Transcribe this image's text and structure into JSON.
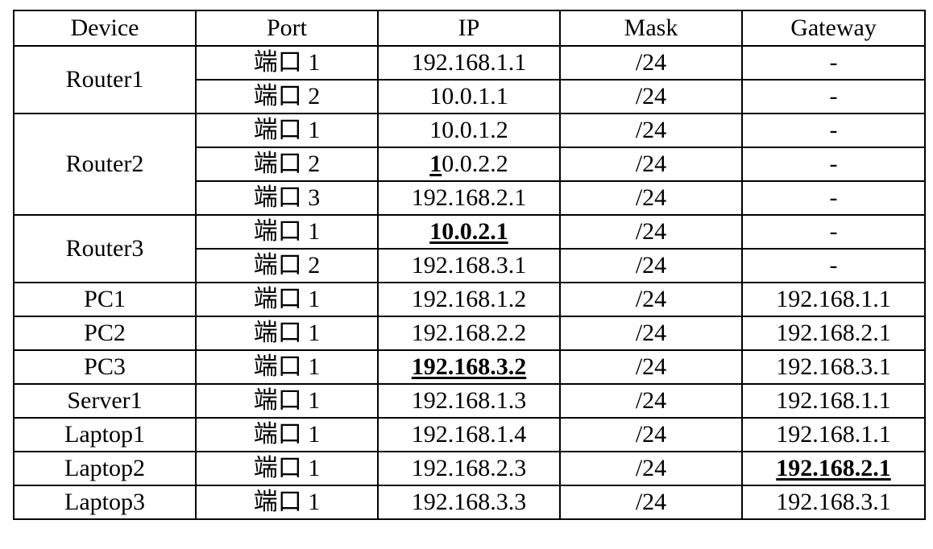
{
  "table": {
    "headers": [
      "Device",
      "Port",
      "IP",
      "Mask",
      "Gateway"
    ],
    "groups": [
      {
        "device": "Router1",
        "rows": [
          {
            "port": "端口 1",
            "ip": "192.168.1.1",
            "mask": "/24",
            "gateway": "-"
          },
          {
            "port": "端口 2",
            "ip": "10.0.1.1",
            "mask": "/24",
            "gateway": "-"
          }
        ]
      },
      {
        "device": "Router2",
        "rows": [
          {
            "port": "端口 1",
            "ip": "10.0.1.2",
            "mask": "/24",
            "gateway": "-"
          },
          {
            "port": "端口 2",
            "ip_emph_prefix": "1",
            "ip_rest": "0.0.2.2",
            "mask": "/24",
            "gateway": "-"
          },
          {
            "port": "端口 3",
            "ip": "192.168.2.1",
            "mask": "/24",
            "gateway": "-"
          }
        ]
      },
      {
        "device": "Router3",
        "rows": [
          {
            "port": "端口 1",
            "ip": "10.0.2.1",
            "ip_emphasized": true,
            "mask": "/24",
            "gateway": "-"
          },
          {
            "port": "端口 2",
            "ip": "192.168.3.1",
            "mask": "/24",
            "gateway": "-"
          }
        ]
      },
      {
        "device": "PC1",
        "rows": [
          {
            "port": "端口 1",
            "ip": "192.168.1.2",
            "mask": "/24",
            "gateway": "192.168.1.1"
          }
        ]
      },
      {
        "device": "PC2",
        "rows": [
          {
            "port": "端口 1",
            "ip": "192.168.2.2",
            "mask": "/24",
            "gateway": "192.168.2.1"
          }
        ]
      },
      {
        "device": "PC3",
        "rows": [
          {
            "port": "端口 1",
            "ip": "192.168.3.2",
            "ip_emphasized": true,
            "mask": "/24",
            "gateway": "192.168.3.1"
          }
        ]
      },
      {
        "device": "Server1",
        "rows": [
          {
            "port": "端口 1",
            "ip": "192.168.1.3",
            "mask": "/24",
            "gateway": "192.168.1.1"
          }
        ]
      },
      {
        "device": "Laptop1",
        "rows": [
          {
            "port": "端口 1",
            "ip": "192.168.1.4",
            "mask": "/24",
            "gateway": "192.168.1.1"
          }
        ]
      },
      {
        "device": "Laptop2",
        "rows": [
          {
            "port": "端口 1",
            "ip": "192.168.2.3",
            "mask": "/24",
            "gateway": "192.168.2.1",
            "gateway_emphasized": true
          }
        ]
      },
      {
        "device": "Laptop3",
        "rows": [
          {
            "port": "端口 1",
            "ip": "192.168.3.3",
            "mask": "/24",
            "gateway": "192.168.3.1"
          }
        ]
      }
    ]
  }
}
